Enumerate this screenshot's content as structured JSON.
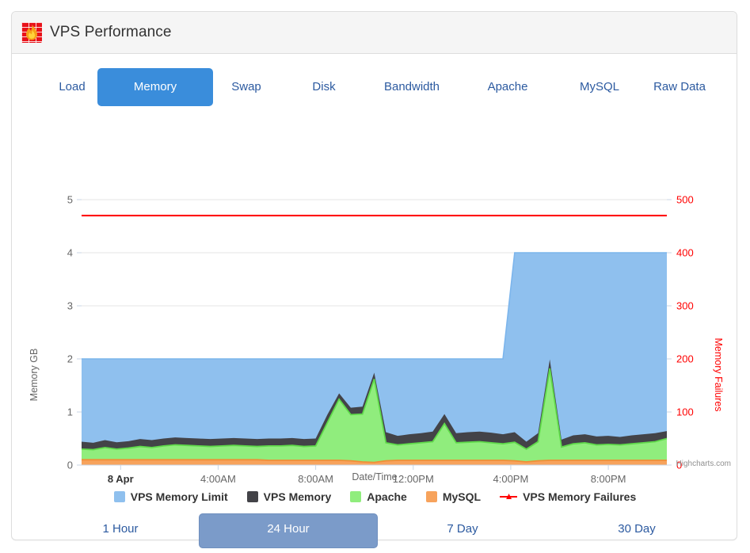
{
  "header": {
    "title": "VPS Performance",
    "icon": "firewall-flame-icon"
  },
  "tabs": [
    {
      "label": "Load",
      "active": false
    },
    {
      "label": "Memory",
      "active": true
    },
    {
      "label": "Swap",
      "active": false
    },
    {
      "label": "Disk",
      "active": false
    },
    {
      "label": "Bandwidth",
      "active": false
    },
    {
      "label": "Apache",
      "active": false
    },
    {
      "label": "MySQL",
      "active": false
    },
    {
      "label": "Raw Data",
      "active": false
    }
  ],
  "ranges": [
    {
      "label": "1 Hour",
      "active": false
    },
    {
      "label": "24 Hour",
      "active": true
    },
    {
      "label": "7 Day",
      "active": false
    },
    {
      "label": "30 Day",
      "active": false
    }
  ],
  "credit": "Highcharts.com",
  "colors": {
    "limit": "#8fc0ee",
    "limit_line": "#7cb5ec",
    "memory": "#434348",
    "apache": "#90ed7d",
    "apache_line": "#5fd94a",
    "mysql": "#f7a35c",
    "mysql_line": "#ef8e37",
    "failures": "#ff0000",
    "accent": "#3a8ddb",
    "range_accent": "#7b9bc9",
    "link": "#2c5aa0"
  },
  "chart_data": {
    "type": "area",
    "title": "",
    "xlabel": "Date/Time",
    "ylabel": "Memory GB",
    "y2label": "Memory Failures",
    "ylim": [
      0,
      5
    ],
    "y2lim": [
      0,
      500
    ],
    "yticks": [
      "0",
      "1",
      "2",
      "3",
      "4",
      "5"
    ],
    "y2ticks": [
      "0",
      "100",
      "200",
      "300",
      "400",
      "500"
    ],
    "xticks": [
      "8 Apr",
      "4:00AM",
      "8:00AM",
      "12:00PM",
      "4:00PM",
      "8:00PM"
    ],
    "xtick_positions": [
      0.0667,
      0.2333,
      0.4,
      0.5667,
      0.7333,
      0.9
    ],
    "grid": true,
    "legend_position": "bottom",
    "stacking": "normal",
    "x": [
      0,
      0.02,
      0.04,
      0.06,
      0.08,
      0.1,
      0.12,
      0.14,
      0.16,
      0.18,
      0.2,
      0.22,
      0.24,
      0.26,
      0.28,
      0.3,
      0.32,
      0.34,
      0.36,
      0.38,
      0.4,
      0.42,
      0.44,
      0.46,
      0.48,
      0.5,
      0.52,
      0.54,
      0.56,
      0.58,
      0.6,
      0.62,
      0.64,
      0.66,
      0.68,
      0.7,
      0.72,
      0.74,
      0.76,
      0.78,
      0.8,
      0.82,
      0.84,
      0.86,
      0.88,
      0.9,
      0.92,
      0.94,
      0.96,
      0.98,
      1.0
    ],
    "series": [
      {
        "name": "VPS Memory Limit",
        "color": "#8fc0ee",
        "type": "area",
        "axis": "left",
        "values": [
          2,
          2,
          2,
          2,
          2,
          2,
          2,
          2,
          2,
          2,
          2,
          2,
          2,
          2,
          2,
          2,
          2,
          2,
          2,
          2,
          2,
          2,
          2,
          2,
          2,
          2,
          2,
          2,
          2,
          2,
          2,
          2,
          2,
          2,
          2,
          2,
          2,
          4,
          4,
          4,
          4,
          4,
          4,
          4,
          4,
          4,
          4,
          4,
          4,
          4,
          4
        ]
      },
      {
        "name": "VPS Memory",
        "color": "#434348",
        "type": "area",
        "axis": "left",
        "values": [
          0.44,
          0.42,
          0.47,
          0.43,
          0.45,
          0.49,
          0.47,
          0.5,
          0.52,
          0.51,
          0.5,
          0.49,
          0.5,
          0.51,
          0.5,
          0.49,
          0.5,
          0.5,
          0.51,
          0.49,
          0.5,
          0.95,
          1.35,
          1.08,
          1.1,
          1.74,
          0.62,
          0.55,
          0.58,
          0.6,
          0.63,
          0.96,
          0.6,
          0.62,
          0.63,
          0.61,
          0.58,
          0.62,
          0.44,
          0.6,
          1.99,
          0.48,
          0.56,
          0.58,
          0.54,
          0.55,
          0.53,
          0.56,
          0.58,
          0.6,
          0.64
        ]
      },
      {
        "name": "Apache",
        "color": "#90ed7d",
        "type": "area",
        "axis": "left",
        "values": [
          0.3,
          0.29,
          0.33,
          0.3,
          0.32,
          0.35,
          0.33,
          0.36,
          0.38,
          0.37,
          0.36,
          0.35,
          0.36,
          0.37,
          0.36,
          0.35,
          0.36,
          0.36,
          0.37,
          0.35,
          0.36,
          0.8,
          1.24,
          0.95,
          0.96,
          1.62,
          0.42,
          0.38,
          0.4,
          0.42,
          0.44,
          0.78,
          0.42,
          0.43,
          0.44,
          0.42,
          0.4,
          0.43,
          0.3,
          0.44,
          1.82,
          0.34,
          0.4,
          0.42,
          0.38,
          0.39,
          0.38,
          0.4,
          0.42,
          0.44,
          0.5
        ]
      },
      {
        "name": "MySQL",
        "color": "#f7a35c",
        "type": "area",
        "axis": "left",
        "values": [
          0.1,
          0.1,
          0.1,
          0.1,
          0.1,
          0.1,
          0.1,
          0.1,
          0.1,
          0.1,
          0.1,
          0.1,
          0.1,
          0.1,
          0.1,
          0.1,
          0.09,
          0.09,
          0.09,
          0.09,
          0.09,
          0.09,
          0.09,
          0.08,
          0.06,
          0.05,
          0.08,
          0.09,
          0.09,
          0.09,
          0.09,
          0.09,
          0.09,
          0.09,
          0.09,
          0.09,
          0.09,
          0.08,
          0.06,
          0.08,
          0.09,
          0.09,
          0.09,
          0.09,
          0.09,
          0.09,
          0.09,
          0.09,
          0.09,
          0.09,
          0.09
        ]
      },
      {
        "name": "VPS Memory Failures",
        "color": "#ff0000",
        "type": "line",
        "axis": "right",
        "constant_value": 470,
        "values": [
          470,
          470,
          470,
          470,
          470,
          470,
          470,
          470,
          470,
          470,
          470,
          470,
          470,
          470,
          470,
          470,
          470,
          470,
          470,
          470,
          470,
          470,
          470,
          470,
          470,
          470,
          470,
          470,
          470,
          470,
          470,
          470,
          470,
          470,
          470,
          470,
          470,
          470,
          470,
          470,
          470,
          470,
          470,
          470,
          470,
          470,
          470,
          470,
          470,
          470,
          470
        ]
      }
    ]
  }
}
